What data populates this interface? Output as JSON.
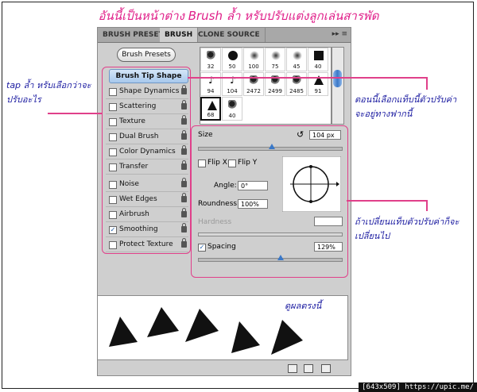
{
  "title": "อันนี้เป็นหน้าต่าง Brush ล้ำ หรับปรับแต่งลูกเล่นสารพัด",
  "tabs": [
    "BRUSH PRESETS",
    "BRUSH",
    "CLONE SOURCE"
  ],
  "active_tab": "BRUSH",
  "presets_button": "Brush Presets",
  "tip_shape_label": "Brush Tip Shape",
  "options": [
    {
      "label": "Shape Dynamics",
      "checked": false
    },
    {
      "label": "Scattering",
      "checked": false
    },
    {
      "label": "Texture",
      "checked": false
    },
    {
      "label": "Dual Brush",
      "checked": false
    },
    {
      "label": "Color Dynamics",
      "checked": false
    },
    {
      "label": "Transfer",
      "checked": false
    },
    {
      "label": "Noise",
      "checked": false
    },
    {
      "label": "Wet Edges",
      "checked": false
    },
    {
      "label": "Airbrush",
      "checked": false
    },
    {
      "label": "Smoothing",
      "checked": true
    },
    {
      "label": "Protect Texture",
      "checked": false
    }
  ],
  "brush_sizes": [
    "32",
    "50",
    "100",
    "75",
    "45",
    "40",
    "94",
    "104",
    "2472",
    "2499",
    "2485",
    "91",
    "68",
    "40"
  ],
  "selected_brush": "68",
  "size": {
    "label": "Size",
    "value": "104 px"
  },
  "flip_x": "Flip X",
  "flip_y": "Flip Y",
  "angle": {
    "label": "Angle:",
    "value": "0°"
  },
  "roundness": {
    "label": "Roundness:",
    "value": "100%"
  },
  "hardness": {
    "label": "Hardness"
  },
  "spacing": {
    "label": "Spacing",
    "value": "129%",
    "checked": true
  },
  "notes": {
    "left": "tap ล้ำ หรับเลือกว่าจะปรับอะไร",
    "right_top": "ตอนนี้เลือกแท็บนี้ตัวปรับค่าจะอยู่ทางฟากนี้",
    "right_bottom": "ถ้าเปลี่ยนแท็บตัวปรับค่าก็จะเปลี่ยนไป",
    "preview": "ดูผลตรงนี้"
  },
  "credit": "[643x509] https://upic.me/",
  "colors": {
    "annotation": "#e0408a",
    "note_text": "#1a1aa0",
    "selection": "#3a78c8"
  }
}
